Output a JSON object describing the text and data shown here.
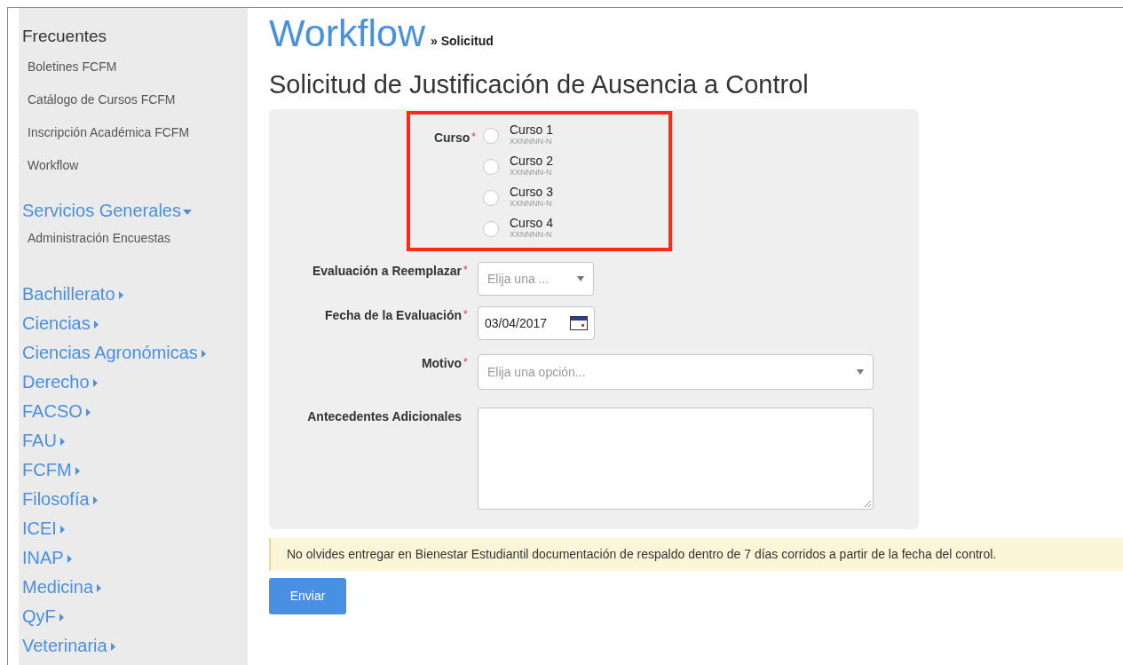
{
  "sidebar": {
    "frequent": {
      "title": "Frecuentes",
      "items": [
        "Boletines FCFM",
        "Catálogo de Cursos FCFM",
        "Inscripción Académica FCFM",
        "Workflow"
      ]
    },
    "sections": [
      {
        "label": "Servicios Generales",
        "expanded": true,
        "children": [
          "Administración Encuestas"
        ]
      },
      {
        "label": "Bachillerato",
        "expanded": false
      },
      {
        "label": "Ciencias",
        "expanded": false
      },
      {
        "label": "Ciencias Agronómicas",
        "expanded": false
      },
      {
        "label": "Derecho",
        "expanded": false
      },
      {
        "label": "FACSO",
        "expanded": false
      },
      {
        "label": "FAU",
        "expanded": false
      },
      {
        "label": "FCFM",
        "expanded": false
      },
      {
        "label": "Filosofía",
        "expanded": false
      },
      {
        "label": "ICEI",
        "expanded": false
      },
      {
        "label": "INAP",
        "expanded": false
      },
      {
        "label": "Medicina",
        "expanded": false
      },
      {
        "label": "QyF",
        "expanded": false
      },
      {
        "label": "Veterinaria",
        "expanded": false
      }
    ]
  },
  "breadcrumb": {
    "app": "Workflow",
    "separator": "»",
    "current": "Solicitud"
  },
  "title": "Solicitud de Justificación de Ausencia a Control",
  "form": {
    "fields": [
      {
        "kind": "radio",
        "label": "Curso",
        "required_mark": "*",
        "highlighted": true,
        "options": [
          {
            "label": "Curso 1",
            "code": "XXNNNN-N",
            "selected": false
          },
          {
            "label": "Curso 2",
            "code": "XXNNNN-N",
            "selected": false
          },
          {
            "label": "Curso 3",
            "code": "XXNNNN-N",
            "selected": false
          },
          {
            "label": "Curso 4",
            "code": "XXNNNN-N",
            "selected": false
          }
        ]
      },
      {
        "kind": "select",
        "label": "Evaluación a Reemplazar",
        "required_mark": "*",
        "compact": true,
        "placeholder": "Elija una ..."
      },
      {
        "kind": "date",
        "label": "Fecha de la Evaluación",
        "required_mark": "*",
        "value": "03/04/2017"
      },
      {
        "kind": "select",
        "label": "Motivo",
        "required_mark": "*",
        "compact": false,
        "placeholder": "Elija una opción..."
      },
      {
        "kind": "textarea",
        "label": "Antecedentes Adicionales"
      }
    ]
  },
  "notice": "No olvides entregar en Bienestar Estudiantil documentación de respaldo dentro de 7 días corridos a partir de la fecha del control.",
  "submit": "Enviar"
}
